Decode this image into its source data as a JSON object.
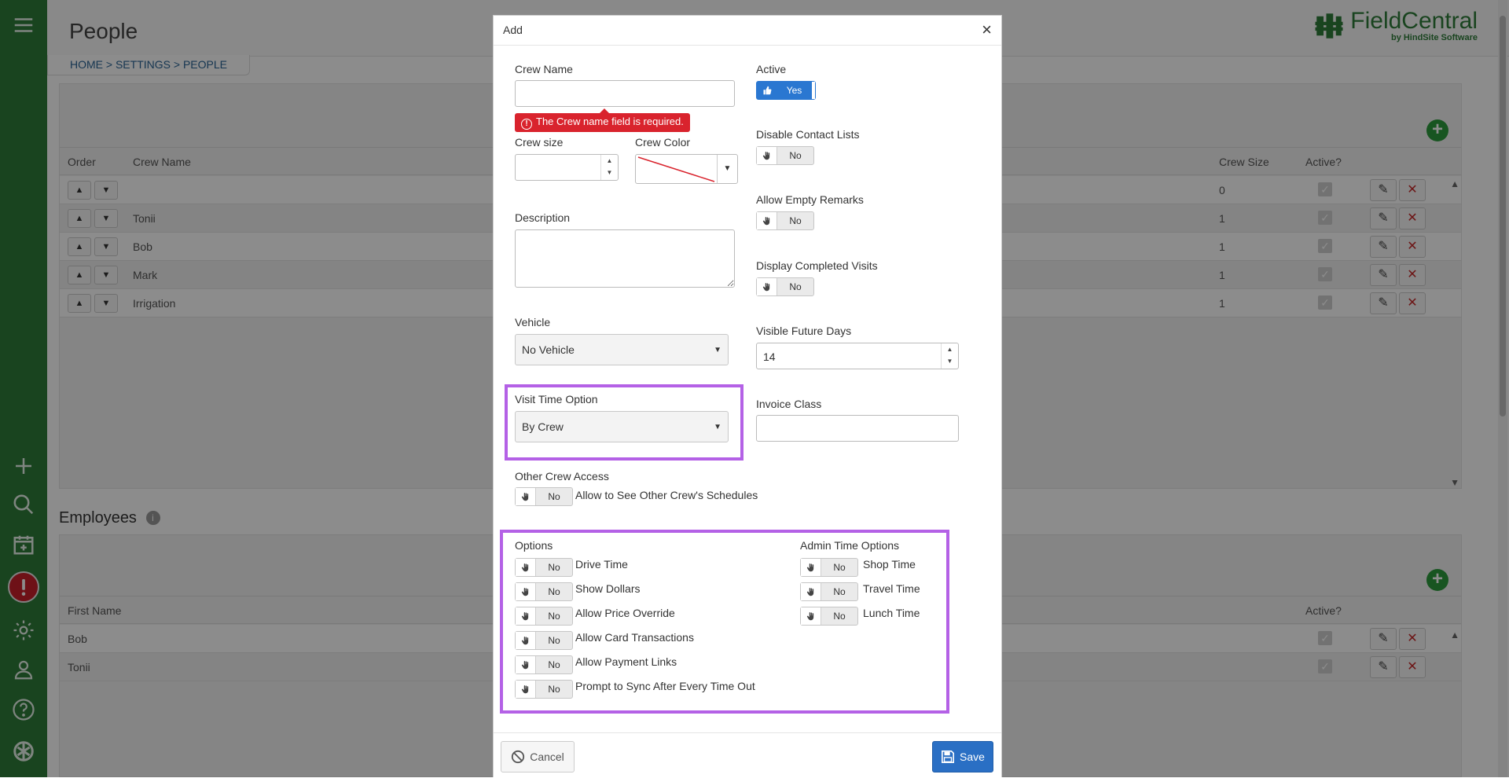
{
  "page": {
    "title": "People",
    "breadcrumb": [
      "HOME",
      ">",
      "SETTINGS",
      ">",
      "PEOPLE"
    ],
    "brand": {
      "name": "FieldCentral",
      "sub": "by HindSite Software",
      "color": "#2f7d3a"
    }
  },
  "crews_table": {
    "columns": [
      "Order",
      "Crew Name",
      "Crew Size",
      "Active?"
    ],
    "rows": [
      {
        "name": "",
        "size": "0"
      },
      {
        "name": "Tonii",
        "size": "1"
      },
      {
        "name": "Bob",
        "size": "1"
      },
      {
        "name": "Mark",
        "size": "1"
      },
      {
        "name": "Irrigation",
        "size": "1"
      }
    ]
  },
  "employees": {
    "title": "Employees",
    "info": "i",
    "columns": [
      "First Name",
      "Active?"
    ],
    "rows": [
      {
        "first": "Bob"
      },
      {
        "first": "Tonii"
      }
    ]
  },
  "modal": {
    "title": "Add",
    "close": "×",
    "crew_name": {
      "label": "Crew Name",
      "value": "",
      "error": "The Crew name field is required."
    },
    "active": {
      "label": "Active",
      "value": "Yes"
    },
    "crew_size": {
      "label": "Crew size",
      "value": ""
    },
    "crew_color": {
      "label": "Crew Color"
    },
    "disable_contact_lists": {
      "label": "Disable Contact Lists",
      "value": "No"
    },
    "allow_empty_remarks": {
      "label": "Allow Empty Remarks",
      "value": "No"
    },
    "display_completed_visits": {
      "label": "Display Completed Visits",
      "value": "No"
    },
    "description": {
      "label": "Description",
      "value": ""
    },
    "vehicle": {
      "label": "Vehicle",
      "value": "No Vehicle"
    },
    "visible_future_days": {
      "label": "Visible Future Days",
      "value": "14"
    },
    "visit_time_option": {
      "label": "Visit Time Option",
      "value": "By Crew"
    },
    "invoice_class": {
      "label": "Invoice Class",
      "value": ""
    },
    "other_crew_access": {
      "label": "Other Crew Access",
      "toggle": "No",
      "text": "Allow to See Other Crew's Schedules"
    },
    "options": {
      "label": "Options",
      "items": [
        {
          "label": "Drive Time",
          "value": "No"
        },
        {
          "label": "Show Dollars",
          "value": "No"
        },
        {
          "label": "Allow Price Override",
          "value": "No"
        },
        {
          "label": "Allow Card Transactions",
          "value": "No"
        },
        {
          "label": "Allow Payment Links",
          "value": "No"
        },
        {
          "label": "Prompt to Sync After Every Time Out",
          "value": "No"
        }
      ]
    },
    "admin_time_options": {
      "label": "Admin Time Options",
      "items": [
        {
          "label": "Shop Time",
          "value": "No"
        },
        {
          "label": "Travel Time",
          "value": "No"
        },
        {
          "label": "Lunch Time",
          "value": "No"
        }
      ]
    },
    "cancel_label": "Cancel",
    "save_label": "Save"
  },
  "colors": {
    "nav": "#2f7d3a",
    "error": "#d9232d",
    "toggle_on": "#2a77d1",
    "highlight": "#b461e6",
    "save": "#2a6fc4"
  },
  "icons": [
    "menu-icon",
    "plus-icon",
    "search-icon",
    "calendar-add-icon",
    "alert-icon",
    "gear-icon",
    "user-icon",
    "help-icon",
    "brand-icon",
    "hand-icon",
    "pencil-icon",
    "delete-icon",
    "cancel-circle-icon",
    "floppy-icon"
  ]
}
